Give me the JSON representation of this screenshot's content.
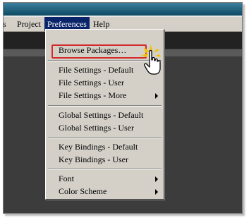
{
  "menubar": {
    "items": [
      {
        "label": "s"
      },
      {
        "label": "Project"
      },
      {
        "label": "Preferences"
      },
      {
        "label": "Help"
      }
    ]
  },
  "preferences_menu": {
    "items": [
      {
        "label": "Browse Packages…",
        "submenu": false
      },
      {
        "label": "File Settings  -  Default",
        "submenu": false
      },
      {
        "label": "File Settings  -  User",
        "submenu": false
      },
      {
        "label": "File Settings  -  More",
        "submenu": true
      },
      {
        "label": "Global Settings  -  Default",
        "submenu": false
      },
      {
        "label": "Global Settings  -  User",
        "submenu": false
      },
      {
        "label": "Key Bindings  -  Default",
        "submenu": false
      },
      {
        "label": "Key Bindings  -  User",
        "submenu": false
      },
      {
        "label": "Font",
        "submenu": true
      },
      {
        "label": "Color Scheme",
        "submenu": true
      }
    ]
  },
  "annotation": {
    "highlight_color": "#d22b2b"
  },
  "cursor": {
    "icon": "hand-pointer-icon"
  },
  "colors": {
    "titlebar": "#0d4a63",
    "menu_bg": "#d4d0c8",
    "menu_active": "#0a246a",
    "editor_bg": "#3c3c3c"
  }
}
